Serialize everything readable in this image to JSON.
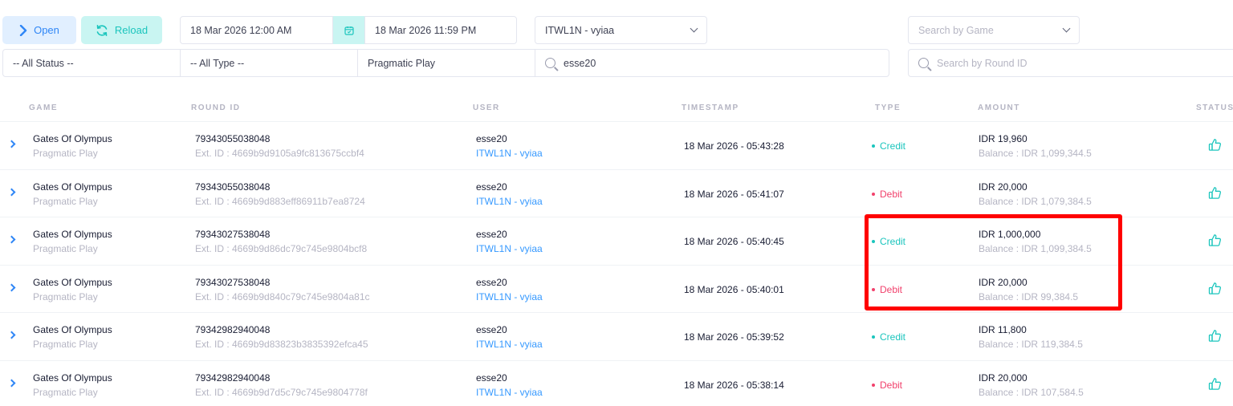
{
  "toolbar": {
    "open_label": "Open",
    "reload_label": "Reload",
    "date_start": "18 Mar 2026 12:00 AM",
    "date_end": "18 Mar 2026 11:59 PM",
    "agent_select": "ITWL1N - vyiaa",
    "game_search_placeholder": "Search by Game"
  },
  "filters": {
    "status": "-- All Status --",
    "type": "-- All Type --",
    "provider": "Pragmatic Play",
    "user_search_value": "esse20",
    "round_search_placeholder": "Search by Round ID"
  },
  "table": {
    "headers": [
      "GAME",
      "ROUND ID",
      "USER",
      "TIMESTAMP",
      "TYPE",
      "AMOUNT",
      "STATUS"
    ],
    "rows": [
      {
        "game": "Gates Of Olympus",
        "provider": "Pragmatic Play",
        "round_id": "79343055038048",
        "ext_id": "Ext. ID : 4669b9d9105a9fc813675ccbf4",
        "user": "esse20",
        "agent": "ITWL1N - vyiaa",
        "timestamp": "18 Mar 2026 - 05:43:28",
        "type": "Credit",
        "amount": "IDR 19,960",
        "balance": "Balance : IDR 1,099,344.5"
      },
      {
        "game": "Gates Of Olympus",
        "provider": "Pragmatic Play",
        "round_id": "79343055038048",
        "ext_id": "Ext. ID : 4669b9d883eff86911b7ea8724",
        "user": "esse20",
        "agent": "ITWL1N - vyiaa",
        "timestamp": "18 Mar 2026 - 05:41:07",
        "type": "Debit",
        "amount": "IDR 20,000",
        "balance": "Balance : IDR 1,079,384.5"
      },
      {
        "game": "Gates Of Olympus",
        "provider": "Pragmatic Play",
        "round_id": "79343027538048",
        "ext_id": "Ext. ID : 4669b9d86dc79c745e9804bcf8",
        "user": "esse20",
        "agent": "ITWL1N - vyiaa",
        "timestamp": "18 Mar 2026 - 05:40:45",
        "type": "Credit",
        "amount": "IDR 1,000,000",
        "balance": "Balance : IDR 1,099,384.5"
      },
      {
        "game": "Gates Of Olympus",
        "provider": "Pragmatic Play",
        "round_id": "79343027538048",
        "ext_id": "Ext. ID : 4669b9d840c79c745e9804a81c",
        "user": "esse20",
        "agent": "ITWL1N - vyiaa",
        "timestamp": "18 Mar 2026 - 05:40:01",
        "type": "Debit",
        "amount": "IDR 20,000",
        "balance": "Balance : IDR 99,384.5"
      },
      {
        "game": "Gates Of Olympus",
        "provider": "Pragmatic Play",
        "round_id": "79342982940048",
        "ext_id": "Ext. ID : 4669b9d83823b3835392efca45",
        "user": "esse20",
        "agent": "ITWL1N - vyiaa",
        "timestamp": "18 Mar 2026 - 05:39:52",
        "type": "Credit",
        "amount": "IDR 11,800",
        "balance": "Balance : IDR 119,384.5"
      },
      {
        "game": "Gates Of Olympus",
        "provider": "Pragmatic Play",
        "round_id": "79342982940048",
        "ext_id": "Ext. ID : 4669b9d7d5c79c745e9804778f",
        "user": "esse20",
        "agent": "ITWL1N - vyiaa",
        "timestamp": "18 Mar 2026 - 05:38:14",
        "type": "Debit",
        "amount": "IDR 20,000",
        "balance": "Balance : IDR 107,584.5"
      }
    ]
  },
  "colors": {
    "primary": "#2f86f6",
    "credit": "#1bc5bd",
    "debit": "#f1416c",
    "highlight": "#ff0000"
  }
}
